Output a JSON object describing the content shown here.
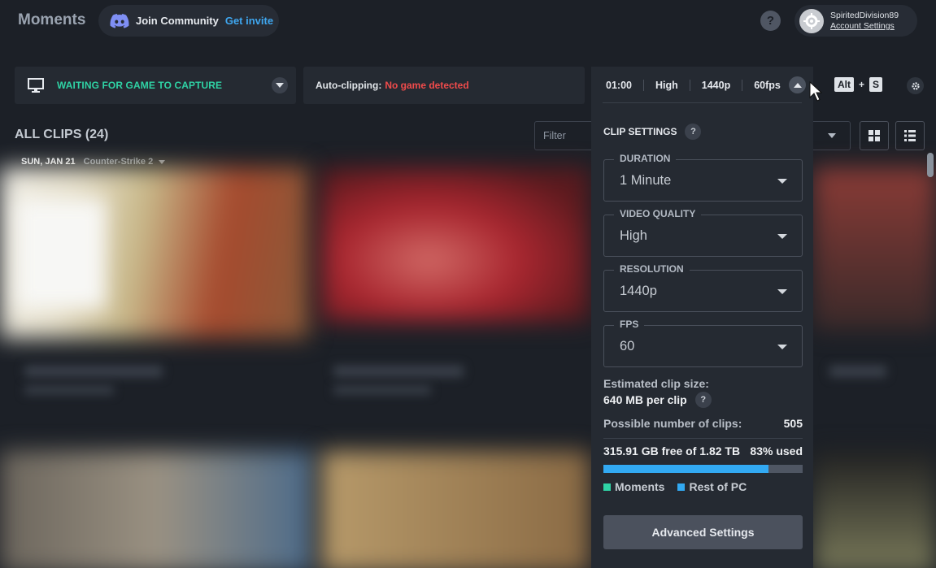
{
  "header": {
    "title": "Moments",
    "community": {
      "join_label": "Join Community",
      "invite_label": "Get invite"
    },
    "help_label": "?",
    "account": {
      "username": "SpiritedDivision89",
      "settings_link": "Account Settings"
    }
  },
  "status": {
    "capture_text": "WAITING FOR GAME TO CAPTURE",
    "autoclip_label": "Auto-clipping:",
    "autoclip_value": "No game detected",
    "autoclip_value_color": "#f04b4b",
    "capture_color": "#2fd3a5"
  },
  "settings_strip": {
    "duration": "01:00",
    "quality": "High",
    "resolution": "1440p",
    "fps": "60fps"
  },
  "hotkey": {
    "key1": "Alt",
    "plus": "+",
    "key2": "S"
  },
  "clips": {
    "heading": "ALL CLIPS (24)",
    "filter_placeholder": "Filter",
    "date": "SUN, JAN 21",
    "game": "Counter-Strike 2"
  },
  "clip_settings": {
    "heading": "CLIP SETTINGS",
    "help": "?",
    "fields": [
      {
        "label": "DURATION",
        "value": "1 Minute"
      },
      {
        "label": "VIDEO QUALITY",
        "value": "High"
      },
      {
        "label": "RESOLUTION",
        "value": "1440p"
      },
      {
        "label": "FPS",
        "value": "60"
      }
    ],
    "estimated_label": "Estimated clip size:",
    "estimated_value": "640 MB per clip",
    "possible_label": "Possible number of clips:",
    "possible_value": "505",
    "storage_free": "315.91 GB free of 1.82 TB",
    "storage_used": "83% used",
    "storage_used_fraction": 0.83,
    "legend": [
      {
        "label": "Moments",
        "color": "#2fd3a5"
      },
      {
        "label": "Rest of PC",
        "color": "#32a9f2"
      }
    ],
    "advanced_button": "Advanced Settings"
  }
}
